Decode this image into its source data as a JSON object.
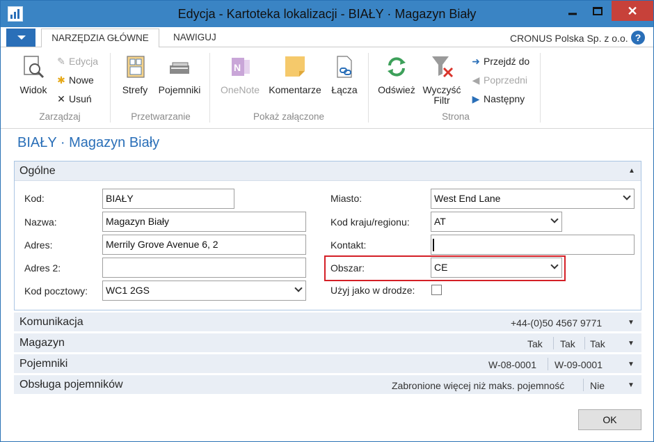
{
  "window": {
    "title": "Edycja - Kartoteka lokalizacji - BIAŁY · Magazyn Biały",
    "close_glyph": "✕"
  },
  "tabs": {
    "home": "NARZĘDZIA GŁÓWNE",
    "navigate": "NAWIGUJ"
  },
  "company": "CRONUS Polska Sp. z o.o.",
  "help_glyph": "?",
  "ribbon": {
    "groups": {
      "manage": "Zarządzaj",
      "process": "Przetwarzanie",
      "attachments": "Pokaż załączone",
      "page": "Strona"
    },
    "view": "Widok",
    "edit": "Edycja",
    "new": "Nowe",
    "delete": "Usuń",
    "zones": "Strefy",
    "bins": "Pojemniki",
    "onenote": "OneNote",
    "comments": "Komentarze",
    "links": "Łącza",
    "refresh": "Odśwież",
    "clear_filter_1": "Wyczyść",
    "clear_filter_2": "Filtr",
    "goto": "Przejdź do",
    "previous": "Poprzedni",
    "next": "Następny"
  },
  "page_title": "BIAŁY · Magazyn Biały",
  "general": {
    "title": "Ogólne",
    "code_label": "Kod:",
    "code_value": "BIAŁY",
    "name_label": "Nazwa:",
    "name_value": "Magazyn Biały",
    "address_label": "Adres:",
    "address_value": "Merrily Grove Avenue 6, 2",
    "address2_label": "Adres 2:",
    "address2_value": "",
    "postcode_label": "Kod pocztowy:",
    "postcode_value": "WC1 2GS",
    "city_label": "Miasto:",
    "city_value": "West End Lane",
    "country_label": "Kod kraju/regionu:",
    "country_value": "AT",
    "contact_label": "Kontakt:",
    "contact_value": "",
    "area_label": "Obszar:",
    "area_value": "CE",
    "in_transit_label": "Użyj jako w drodze:"
  },
  "fasttabs": {
    "communication": {
      "title": "Komunikacja",
      "summary": "+44-(0)50 4567 9771"
    },
    "warehouse": {
      "title": "Magazyn",
      "v1": "Tak",
      "v2": "Tak",
      "v3": "Tak"
    },
    "bins": {
      "title": "Pojemniki",
      "v1": "W-08-0001",
      "v2": "W-09-0001"
    },
    "bin_policies": {
      "title": "Obsługa pojemników",
      "v1": "Zabronione więcej niż maks. pojemność",
      "v2": "Nie"
    }
  },
  "ok": "OK",
  "colors": {
    "titlebar": "#3a84c4",
    "accent": "#2a6fb8",
    "highlight_border": "#d41f26",
    "fasttab_bg": "#e9eef5"
  }
}
